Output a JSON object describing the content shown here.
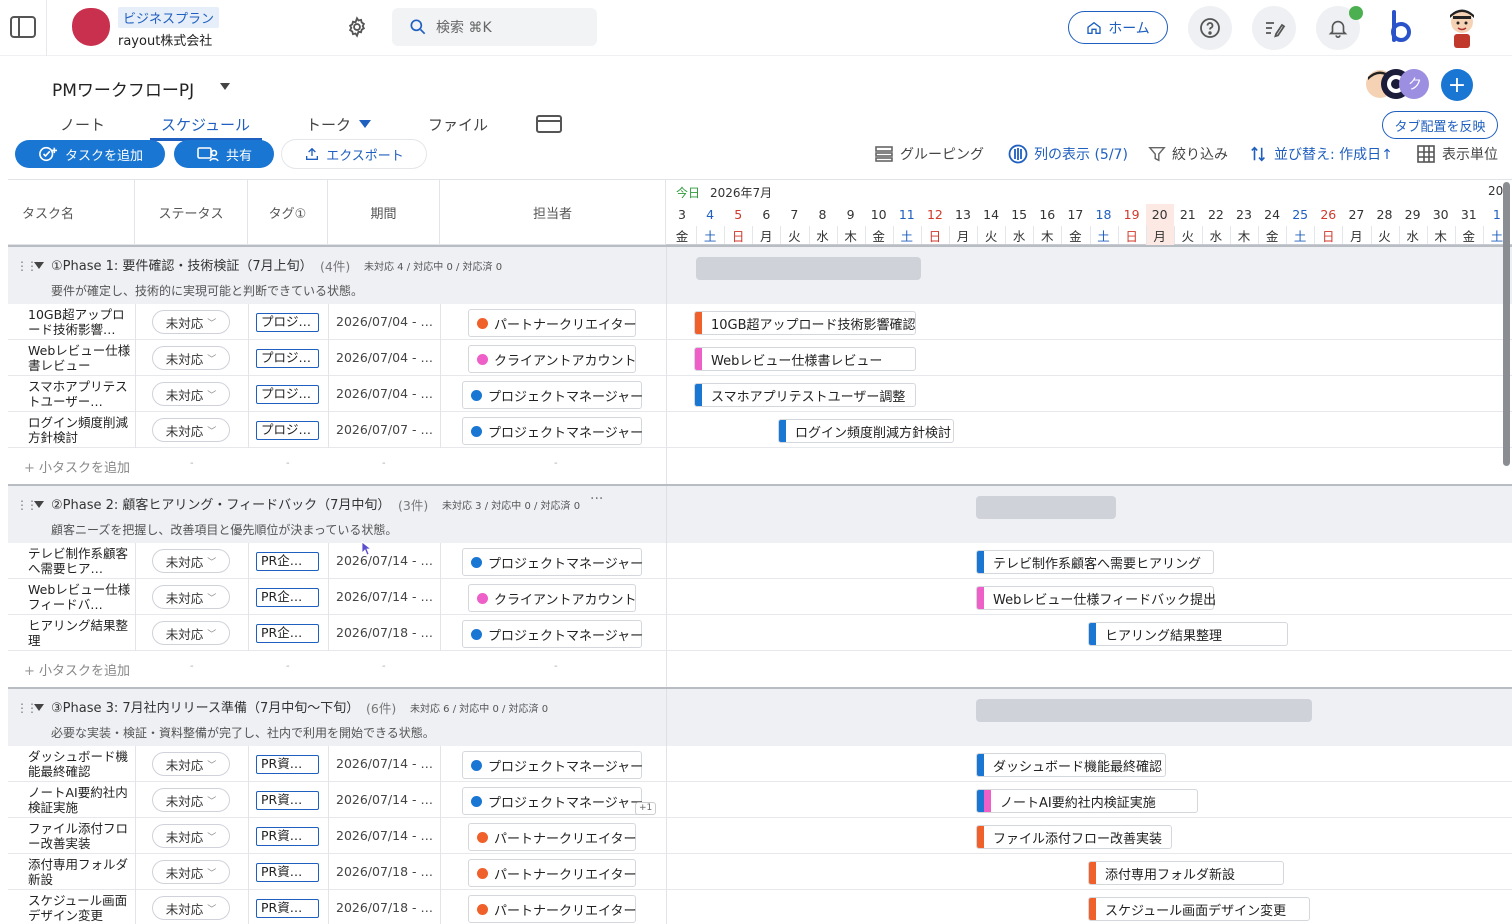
{
  "topbar": {
    "plan": "ビジネスプラン",
    "company": "rayout株式会社",
    "search_placeholder": "検索 ⌘K",
    "home_label": "ホーム",
    "accent": "#1f5fbf",
    "logo_color": "#c8304d",
    "notification_dot_color": "#4caf50"
  },
  "project": {
    "title": "PMワークフローPJ",
    "member_initial": "ク",
    "add_member": "+",
    "tab_layout_button": "タブ配置を反映"
  },
  "tabs": [
    {
      "label": "ノート"
    },
    {
      "label": "スケジュール",
      "active": true
    },
    {
      "label": "トーク"
    },
    {
      "label": "ファイル"
    }
  ],
  "toolbar": {
    "add_task": "タスクを追加",
    "share": "共有",
    "export": "エクスポート",
    "grouping": "グルーピング",
    "columns": "列の表示 (5/7)",
    "filter": "絞り込み",
    "sort": "並び替え: 作成日↑",
    "display_unit": "表示単位"
  },
  "columns": {
    "task": "タスク名",
    "status": "ステータス",
    "tag": "タグ①",
    "period": "期間",
    "assignee": "担当者"
  },
  "timeline": {
    "today": "今日",
    "month": "2026年7月",
    "next_year_partial": "20",
    "days": [
      {
        "d": "3",
        "w": "金"
      },
      {
        "d": "4",
        "w": "土"
      },
      {
        "d": "5",
        "w": "日"
      },
      {
        "d": "6",
        "w": "月"
      },
      {
        "d": "7",
        "w": "火"
      },
      {
        "d": "8",
        "w": "水"
      },
      {
        "d": "9",
        "w": "木"
      },
      {
        "d": "10",
        "w": "金"
      },
      {
        "d": "11",
        "w": "土"
      },
      {
        "d": "12",
        "w": "日"
      },
      {
        "d": "13",
        "w": "月"
      },
      {
        "d": "14",
        "w": "火"
      },
      {
        "d": "15",
        "w": "水"
      },
      {
        "d": "16",
        "w": "木"
      },
      {
        "d": "17",
        "w": "金"
      },
      {
        "d": "18",
        "w": "土"
      },
      {
        "d": "19",
        "w": "日"
      },
      {
        "d": "20",
        "w": "月"
      },
      {
        "d": "21",
        "w": "火"
      },
      {
        "d": "22",
        "w": "水"
      },
      {
        "d": "23",
        "w": "木"
      },
      {
        "d": "24",
        "w": "金"
      },
      {
        "d": "25",
        "w": "土"
      },
      {
        "d": "26",
        "w": "日"
      },
      {
        "d": "27",
        "w": "月"
      },
      {
        "d": "28",
        "w": "火"
      },
      {
        "d": "29",
        "w": "水"
      },
      {
        "d": "30",
        "w": "木"
      },
      {
        "d": "31",
        "w": "金"
      },
      {
        "d": "1",
        "w": "土"
      }
    ],
    "today_date": "20"
  },
  "roles": {
    "partner": {
      "label": "パートナークリエイター",
      "color": "#f0602a"
    },
    "client": {
      "label": "クライアントアカウント",
      "color": "#ee5fc8"
    },
    "pm": {
      "label": "プロジェクトマネージャー",
      "color": "#1976d2"
    }
  },
  "add_subtask": "小タスクを追加",
  "groups": [
    {
      "title": "①Phase 1: 要件確認・技術検証（7月上旬）",
      "count": "(4件)",
      "stats": "未対応 4 / 対応中 0 / 対応済 0",
      "desc": "要件が確定し、技術的に実現可能と判断できている状態。",
      "more": "",
      "tasks": [
        {
          "name": "10GB超アップロード技術影響…",
          "status": "未対応",
          "tag": "プロジ…",
          "period": "2026/07/04 - …",
          "role": "partner",
          "bar": "10GB超アップロード技術影響確認",
          "extra": ""
        },
        {
          "name": "Webレビュー仕様書レビュー",
          "status": "未対応",
          "tag": "プロジ…",
          "period": "2026/07/04 - …",
          "role": "client",
          "bar": "Webレビュー仕様書レビュー",
          "extra": ""
        },
        {
          "name": "スマホアプリテストユーザー…",
          "status": "未対応",
          "tag": "プロジ…",
          "period": "2026/07/04 - …",
          "role": "pm",
          "bar": "スマホアプリテストユーザー調整",
          "extra": ""
        },
        {
          "name": "ログイン頻度削減方針検討",
          "status": "未対応",
          "tag": "プロジ…",
          "period": "2026/07/07 - …",
          "role": "pm",
          "bar": "ログイン頻度削減方針検討",
          "extra": ""
        }
      ]
    },
    {
      "title": "②Phase 2: 顧客ヒアリング・フィードバック（7月中旬）",
      "count": "(3件)",
      "stats": "未対応 3 / 対応中 0 / 対応済 0",
      "desc": "顧客ニーズを把握し、改善項目と優先順位が決まっている状態。",
      "more": "···",
      "tasks": [
        {
          "name": "テレビ制作系顧客へ需要ヒア…",
          "status": "未対応",
          "tag": "PR企…",
          "period": "2026/07/14 - …",
          "role": "pm",
          "bar": "テレビ制作系顧客へ需要ヒアリング",
          "extra": ""
        },
        {
          "name": "Webレビュー仕様フィードバ…",
          "status": "未対応",
          "tag": "PR企…",
          "period": "2026/07/14 - …",
          "role": "client",
          "bar": "Webレビュー仕様フィードバック提出",
          "extra": ""
        },
        {
          "name": "ヒアリング結果整理",
          "status": "未対応",
          "tag": "PR企…",
          "period": "2026/07/18 - …",
          "role": "pm",
          "bar": "ヒアリング結果整理",
          "extra": ""
        }
      ]
    },
    {
      "title": "③Phase 3: 7月社内リリース準備（7月中旬〜下旬）",
      "count": "(6件)",
      "stats": "未対応 6 / 対応中 0 / 対応済 0",
      "desc": "必要な実装・検証・資料整備が完了し、社内で利用を開始できる状態。",
      "more": "",
      "tasks": [
        {
          "name": "ダッシュボード機能最終確認",
          "status": "未対応",
          "tag": "PR資…",
          "period": "2026/07/14 - …",
          "role": "pm",
          "bar": "ダッシュボード機能最終確認",
          "extra": ""
        },
        {
          "name": "ノートAI要約社内検証実施",
          "status": "未対応",
          "tag": "PR資…",
          "period": "2026/07/14 - …",
          "role": "pm",
          "bar": "ノートAI要約社内検証実施",
          "extra": "+1"
        },
        {
          "name": "ファイル添付フロー改善実装",
          "status": "未対応",
          "tag": "PR資…",
          "period": "2026/07/14 - …",
          "role": "partner",
          "bar": "ファイル添付フロー改善実装",
          "extra": ""
        },
        {
          "name": "添付専用フォルダ新設",
          "status": "未対応",
          "tag": "PR資…",
          "period": "2026/07/18 - …",
          "role": "partner",
          "bar": "添付専用フォルダ新設",
          "extra": ""
        },
        {
          "name": "スケジュール画面デザイン変更",
          "status": "未対応",
          "tag": "PR資…",
          "period": "2026/07/18 - …",
          "role": "partner",
          "bar": "スケジュール画面デザイン変更",
          "extra": ""
        }
      ]
    }
  ]
}
